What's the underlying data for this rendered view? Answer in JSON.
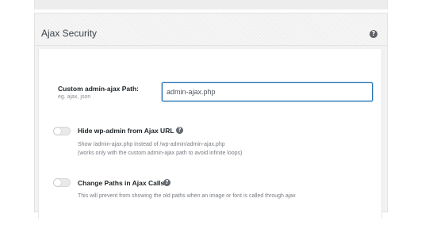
{
  "panel": {
    "title": "Ajax Security",
    "help_icon_glyph": "?"
  },
  "custom_path": {
    "label": "Custom admin-ajax Path:",
    "hint": "eg. ajax, json",
    "value": "admin-ajax.php"
  },
  "options": [
    {
      "title": "Hide wp-admin from Ajax URL",
      "enabled": false,
      "help_glyph": "?",
      "desc_line1": "Show /admin-ajax.php instead of /wp-admin/admin-ajax.php",
      "desc_line2": "(works only with the custom admin-ajax path to avoid infinite loops)"
    },
    {
      "title": "Change Paths in Ajax Calls",
      "enabled": false,
      "help_glyph": "?",
      "desc_line1": "This will prevent from showing the old paths when an image or font is called through ajax"
    }
  ],
  "colors": {
    "input_focus_border": "#2271b1",
    "toggle_off": "#e9e9e9"
  },
  "icons": {
    "header_help": "help-circle-icon",
    "option_help": "question-circle-icon"
  }
}
